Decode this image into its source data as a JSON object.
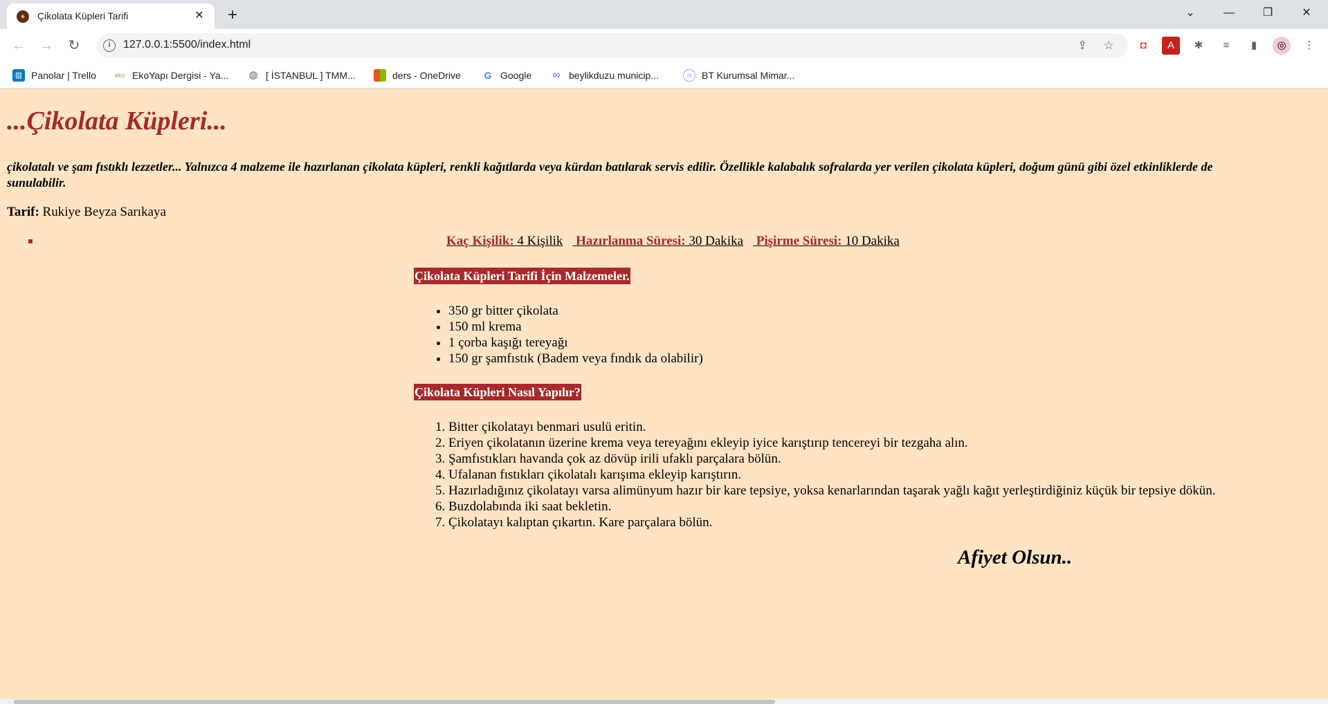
{
  "browser": {
    "tab_title": "Çikolata Küpleri Tarifi",
    "url": "127.0.0.1:5500/index.html",
    "bookmarks": [
      {
        "label": "Panolar | Trello",
        "icon": "trello-icon"
      },
      {
        "label": "EkoYapı Dergisi - Ya...",
        "icon": "eko-icon"
      },
      {
        "label": "[ İSTANBUL ] TMM...",
        "icon": "globe-icon"
      },
      {
        "label": "ders - OneDrive",
        "icon": "microsoft-icon"
      },
      {
        "label": "Google",
        "icon": "google-icon"
      },
      {
        "label": "beylikduzu municip...",
        "icon": "link-icon"
      },
      {
        "label": "BT Kurumsal Mimar...",
        "icon": "br-icon"
      }
    ]
  },
  "page": {
    "title": "...Çikolata Küpleri...",
    "intro": "çikolatalı ve şam fıstıklı lezzetler... Yalnızca 4 malzeme ile hazırlanan çikolata küpleri, renkli kağıtlarda veya kürdan batılarak servis edilir. Özellikle kalabalık sofralarda yer verilen çikolata küpleri, doğum günü gibi özel etkinliklerde de sunulabilir.",
    "author_label": "Tarif:",
    "author_name": "Rukiye Beyza Sarıkaya",
    "meta": {
      "servings_label": "Kaç Kişilik:",
      "servings_value": "4 Kişilik",
      "prep_label": "Hazırlanma Süresi:",
      "prep_value": "30 Dakika",
      "cook_label": "Pişirme Süresi:",
      "cook_value": "10 Dakika"
    },
    "ingredients_heading": "Çikolata Küpleri Tarifi İçin Malzemeler.",
    "ingredients": [
      "350 gr bitter çikolata",
      "150 ml krema",
      "1 çorba kaşığı tereyağı",
      "150 gr şamfıstık (Badem veya fındık da olabilir)"
    ],
    "steps_heading": "Çikolata Küpleri Nasıl Yapılır?",
    "steps": [
      "Bitter çikolatayı benmari usulü eritin.",
      "Eriyen çikolatanın üzerine krema veya tereyağını ekleyip iyice karıştırıp tencereyi bir tezgaha alın.",
      "Şamfıstıkları havanda çok az dövüp irili ufaklı parçalara bölün.",
      "Ufalanan fıstıkları çikolatalı karışıma ekleyip karıştırın.",
      "Hazırladığınız çikolatayı varsa alimünyum hazır bir kare tepsiye, yoksa kenarlarından taşarak yağlı kağıt yerleştirdiğiniz küçük bir tepsiye dökün.",
      "Buzdolabında iki saat bekletin.",
      "Çikolatayı kalıptan çıkartın. Kare parçalara bölün."
    ],
    "closing": "Afiyet Olsun.."
  },
  "colors": {
    "page_background": "#ffe4c4",
    "accent": "#a52a2a"
  }
}
